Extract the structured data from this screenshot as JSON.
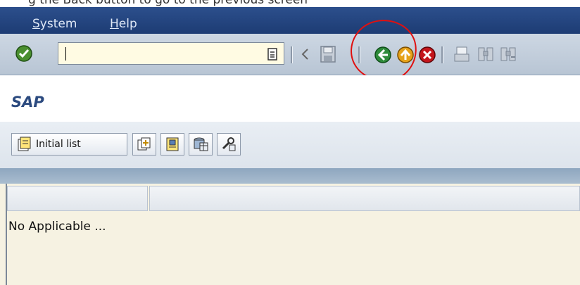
{
  "caption": {
    "partial_text": "g the Back button to go to the previous screen"
  },
  "menu": {
    "items": [
      "System",
      "Help"
    ]
  },
  "toolbar": {
    "command_field_value": "",
    "icons": [
      "enter-icon",
      "command-dropdown-icon",
      "prev-icon",
      "save-icon",
      "back-icon",
      "exit-icon",
      "cancel-icon",
      "print-icon",
      "find-icon",
      "find-next-icon"
    ]
  },
  "screen": {
    "title": "SAP"
  },
  "app_toolbar": {
    "initial_list_label": "Initial list",
    "icons": [
      "initial-list-icon",
      "new-entry-icon",
      "details-icon",
      "table-icon",
      "settings-icon"
    ]
  },
  "list": {
    "headers": [
      "",
      ""
    ],
    "rows": [
      "No Applicable ..."
    ]
  },
  "colors": {
    "menubar": "#1d3c74",
    "toolbar": "#c2ccd9",
    "annotation": "#e01010",
    "list_bg": "#f6f2e2"
  }
}
